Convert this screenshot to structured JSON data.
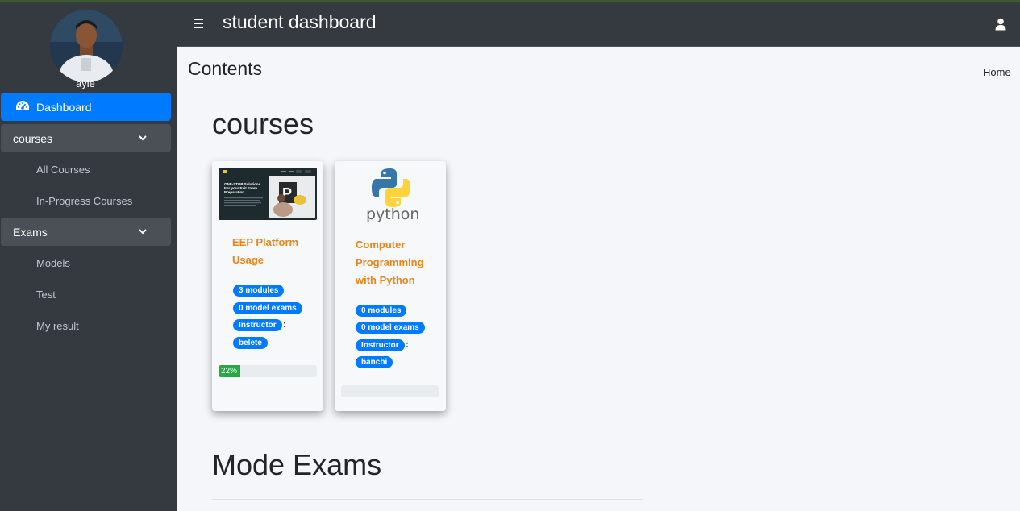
{
  "sidebar": {
    "username": "ayle",
    "dashboard": "Dashboard",
    "courses_group": "courses",
    "all_courses": "All Courses",
    "in_progress": "In-Progress Courses",
    "exams_group": "Exams",
    "models": "Models",
    "test": "Test",
    "my_result": "My result"
  },
  "header": {
    "title": "student dashboard"
  },
  "page": {
    "title": "Contents",
    "breadcrumb": "Home",
    "courses_heading": "courses",
    "mode_exams_heading": "Mode Exams"
  },
  "courses": [
    {
      "title_line1": "EEP Platform",
      "title_line2": "Usage",
      "modules": "3 modules",
      "model_exams": "0 model exams",
      "instructor_label": "Instructor",
      "instructor": "belete",
      "progress_label": "22%",
      "progress": 0.22,
      "thumb_text": "ONE-STOP Solutions For your Exit Exam Preparation"
    },
    {
      "title_line1": "Computer",
      "title_line2": "Programming",
      "title_line3": "with Python",
      "modules": "0 modules",
      "model_exams": "0 model exams",
      "instructor_label": "Instructor",
      "instructor": "banchi",
      "progress": 0,
      "logo_text": "python"
    }
  ],
  "colors": {
    "sidebar_bg": "#343a40",
    "active": "#007bff",
    "course_title": "#e8841a",
    "progress": "#28a745"
  }
}
